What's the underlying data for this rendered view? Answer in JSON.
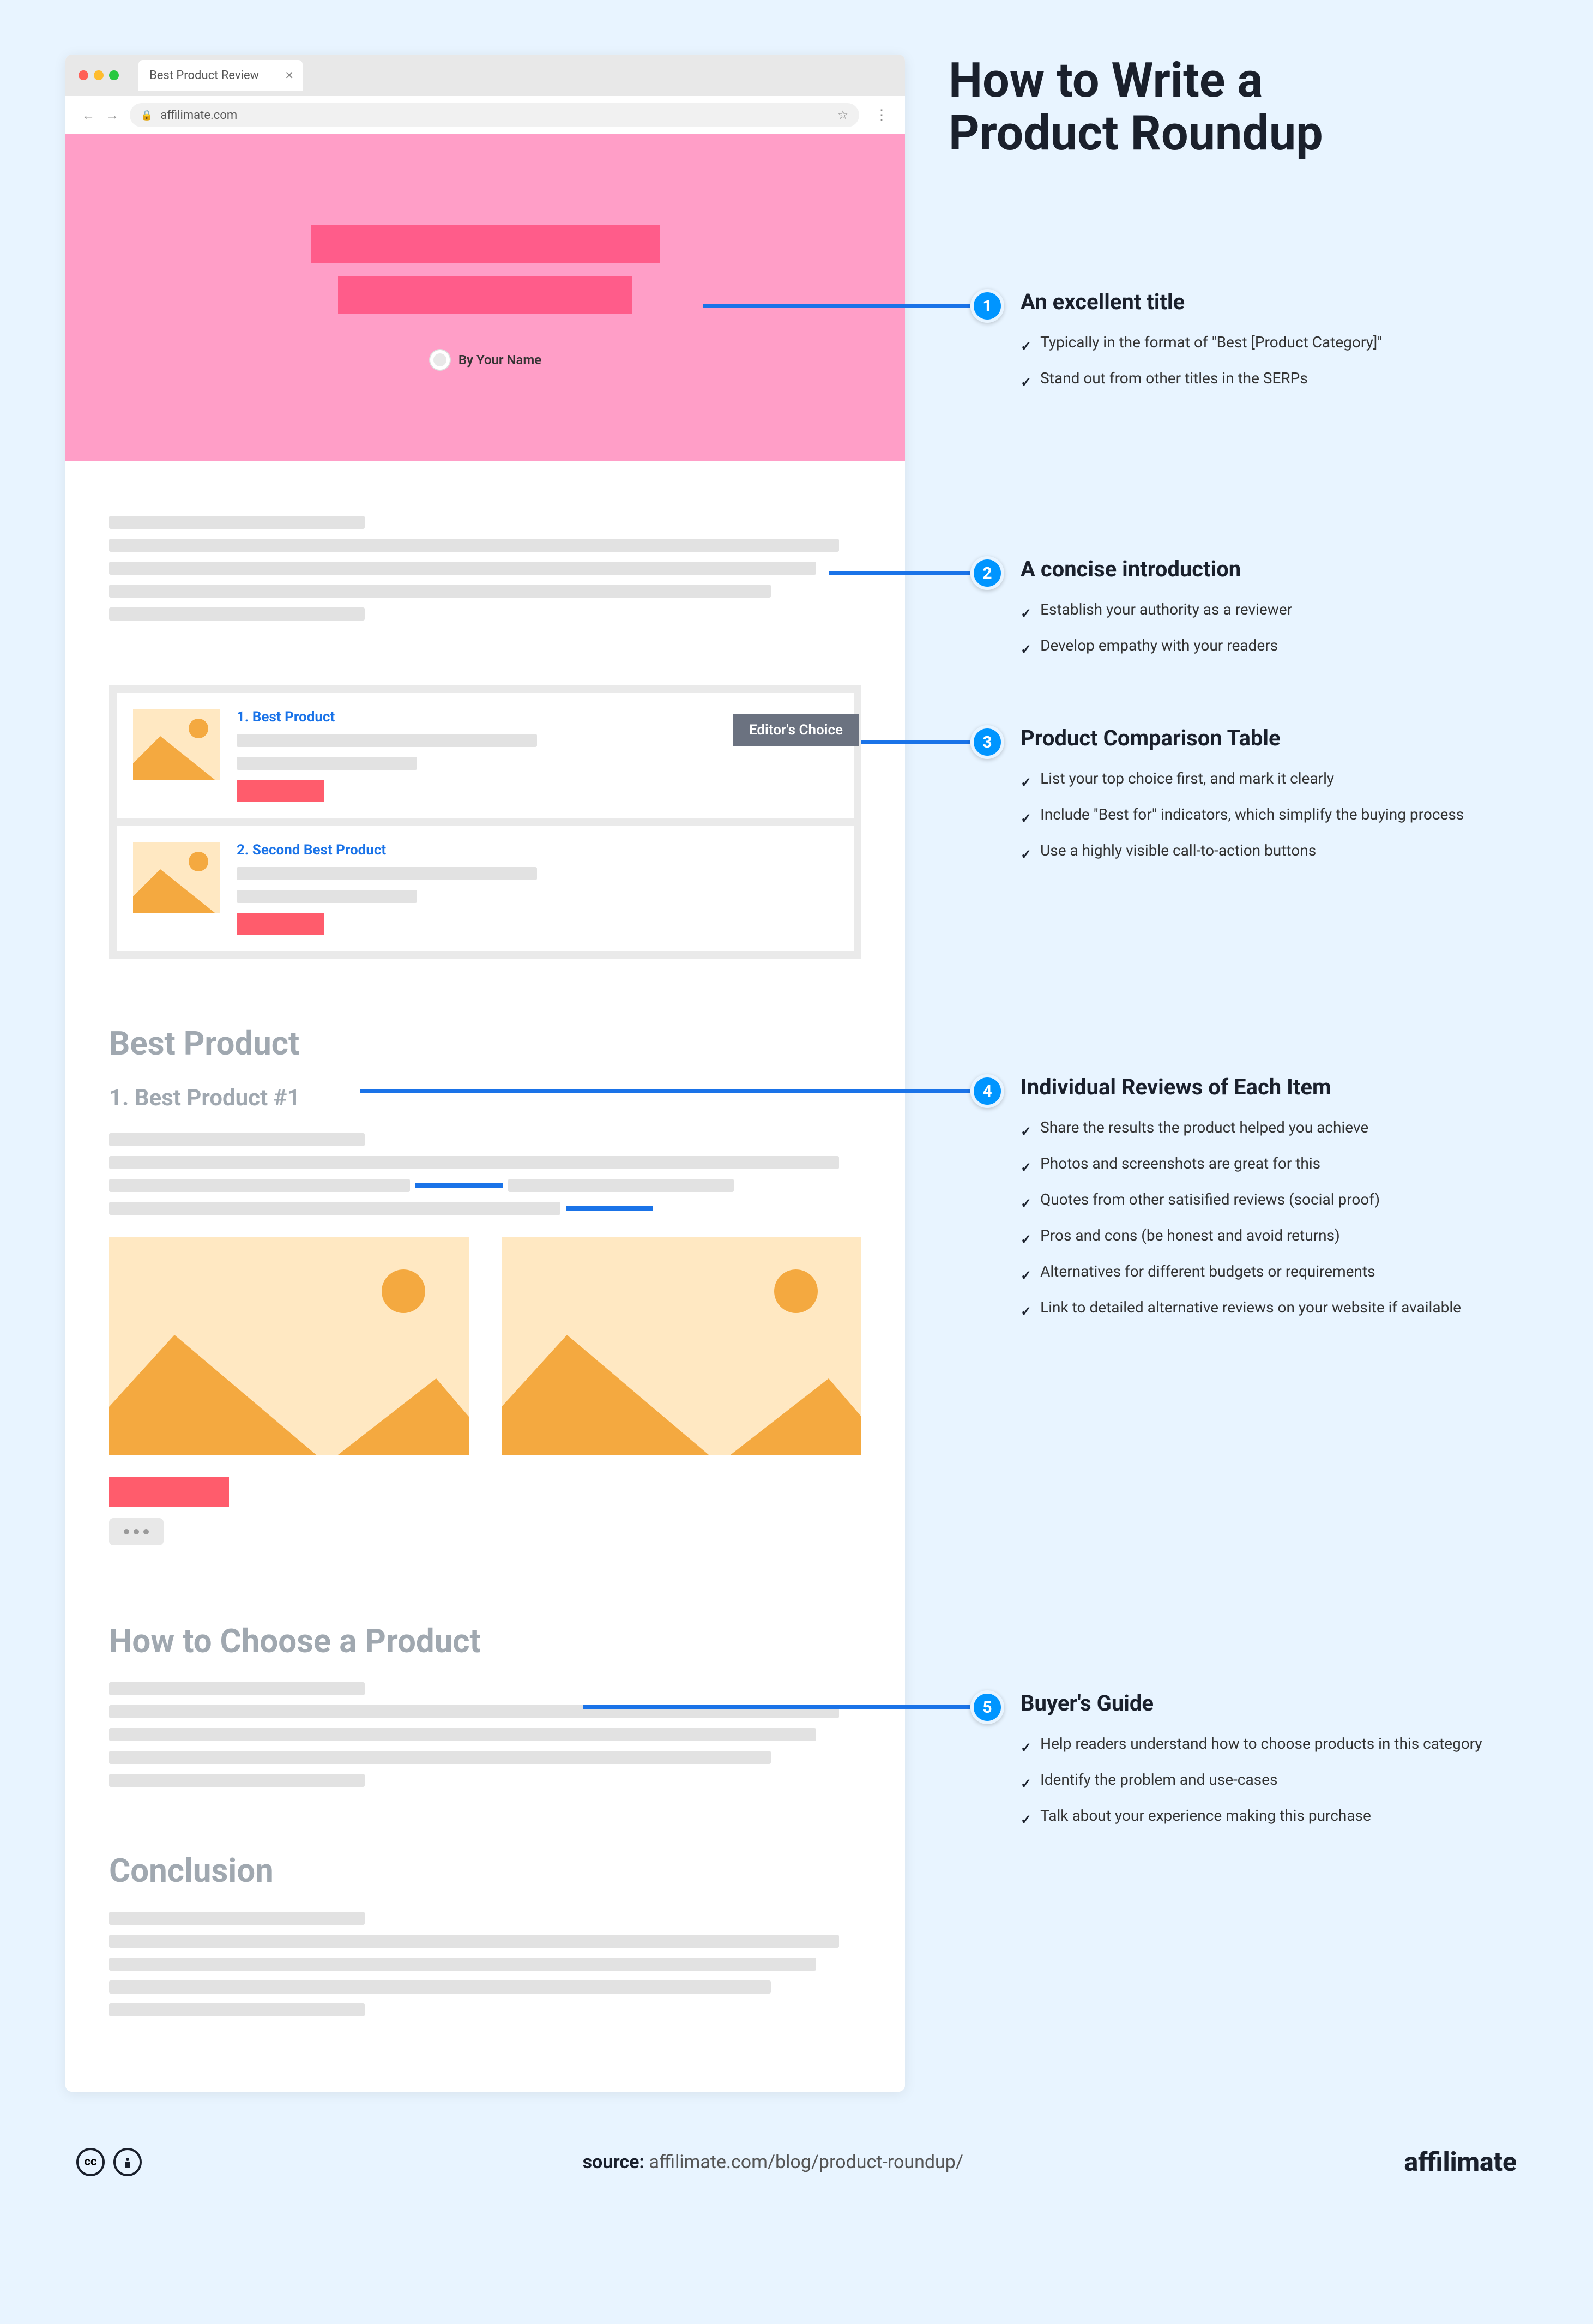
{
  "title": "How to Write a\nProduct Roundup",
  "browser": {
    "tab_title": "Best Product Review",
    "url_host": "affilimate.com"
  },
  "hero": {
    "byline": "By Your Name"
  },
  "comp_table": {
    "row1_title": "1. Best Product",
    "row2_title": "2. Second Best Product",
    "badge": "Editor's Choice"
  },
  "sections": {
    "best_product_h2": "Best Product",
    "best_product_h3": "1.  Best Product #1",
    "buyers_guide_h2": "How to Choose a Product",
    "conclusion_h2": "Conclusion"
  },
  "callouts": [
    {
      "num": "1",
      "title": "An excellent title",
      "items": [
        "Typically in the format of \"Best [Product Category]\"",
        "Stand out from other titles in the SERPs"
      ]
    },
    {
      "num": "2",
      "title": "A concise introduction",
      "items": [
        "Establish your authority as a reviewer",
        "Develop empathy with your readers"
      ]
    },
    {
      "num": "3",
      "title": "Product Comparison Table",
      "items": [
        "List your top choice first, and mark it clearly",
        "Include \"Best for\" indicators, which simplify the buying process",
        "Use a highly visible call-to-action buttons"
      ]
    },
    {
      "num": "4",
      "title": "Individual Reviews of Each Item",
      "items": [
        "Share the results the product helped you achieve",
        "Photos and screenshots are great for this",
        "Quotes from other satisified reviews (social proof)",
        "Pros and cons (be honest and avoid returns)",
        "Alternatives for different budgets or requirements",
        "Link to detailed alternative reviews on your website if available"
      ]
    },
    {
      "num": "5",
      "title": "Buyer's Guide",
      "items": [
        "Help readers understand how to choose products in this category",
        "Identify the problem and use-cases",
        "Talk about your experience making this purchase"
      ]
    }
  ],
  "footer": {
    "source_label": "source:",
    "source_url": "affilimate.com/blog/product-roundup/",
    "logo": "affilimate"
  }
}
